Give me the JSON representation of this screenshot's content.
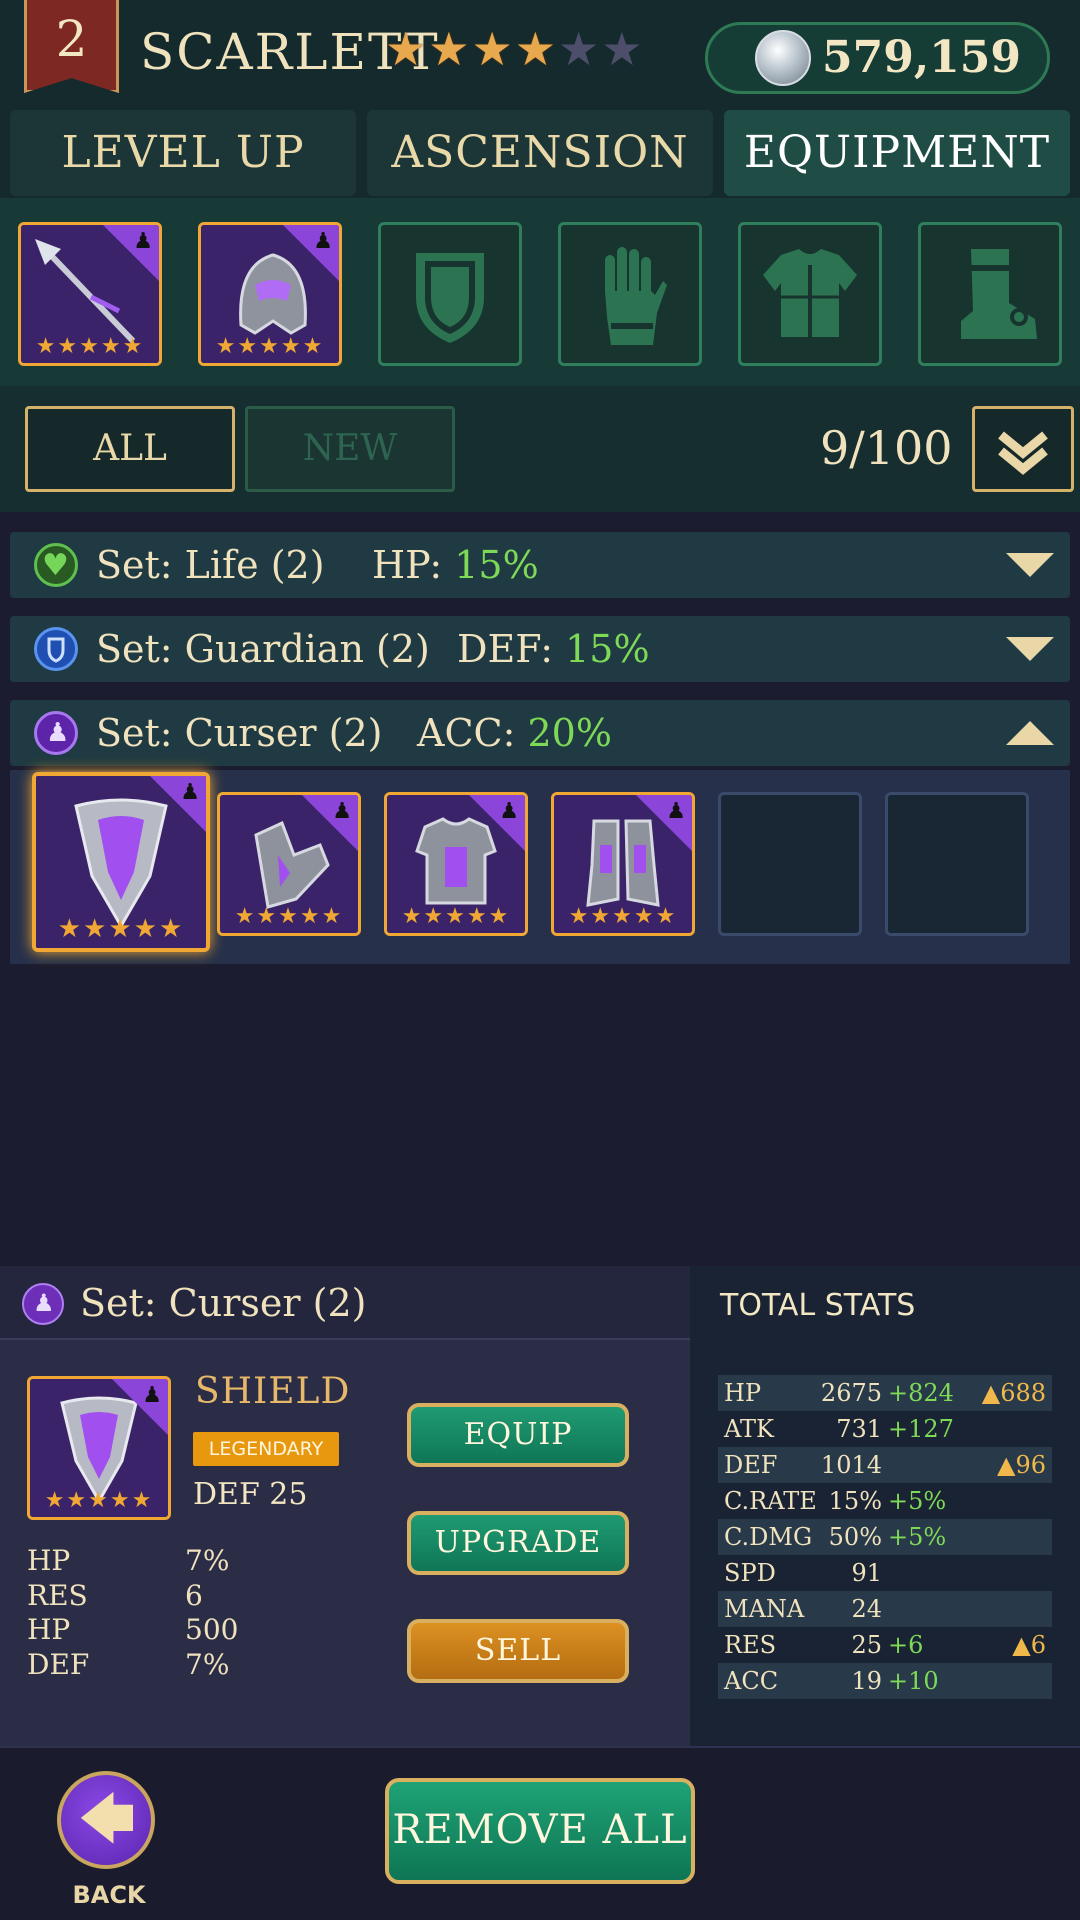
{
  "header": {
    "level": "2",
    "hero_name": "SCARLETT",
    "stars_filled": 4,
    "stars_total": 6,
    "currency": "579,159",
    "currency_icon": "silver-coin-icon"
  },
  "tabs": [
    {
      "label": "LEVEL UP",
      "active": false
    },
    {
      "label": "ASCENSION",
      "active": false
    },
    {
      "label": "EQUIPMENT",
      "active": true
    }
  ],
  "equipped_slots": [
    {
      "slot": "weapon",
      "filled": true,
      "stars": "★★★★★",
      "icon": "spear-icon"
    },
    {
      "slot": "helmet",
      "filled": true,
      "stars": "★★★★★",
      "icon": "helmet-icon"
    },
    {
      "slot": "shield",
      "filled": false,
      "icon": "shield-slot-icon"
    },
    {
      "slot": "gloves",
      "filled": false,
      "icon": "glove-slot-icon"
    },
    {
      "slot": "chest",
      "filled": false,
      "icon": "chest-armor-slot-icon"
    },
    {
      "slot": "boots",
      "filled": false,
      "icon": "boot-slot-icon"
    }
  ],
  "filter": {
    "all_label": "ALL",
    "new_label": "NEW",
    "count": "9/100",
    "sort_icon": "chevron-down-icon"
  },
  "sets": [
    {
      "name": "Set: Life (2)",
      "bonus_label": "HP:",
      "bonus_value": "15%",
      "icon": "heart-icon",
      "color": "#53b04a",
      "expanded": false
    },
    {
      "name": "Set: Guardian (2)",
      "bonus_label": "DEF:",
      "bonus_value": "15%",
      "icon": "guardian-shield-icon",
      "color": "#2f6fd6",
      "expanded": false
    },
    {
      "name": "Set: Curser (2)",
      "bonus_label": "ACC:",
      "bonus_value": "20%",
      "icon": "curser-icon",
      "color": "#7a3ad0",
      "expanded": true
    }
  ],
  "curser_items": [
    {
      "filled": true,
      "selected": true,
      "stars": "★★★★★",
      "icon": "curser-shield-icon"
    },
    {
      "filled": true,
      "selected": false,
      "stars": "★★★★★",
      "icon": "curser-gloves-icon"
    },
    {
      "filled": true,
      "selected": false,
      "stars": "★★★★★",
      "icon": "curser-chest-icon"
    },
    {
      "filled": true,
      "selected": false,
      "stars": "★★★★★",
      "icon": "curser-boots-icon"
    },
    {
      "filled": false
    },
    {
      "filled": false
    }
  ],
  "detail": {
    "set_name": "Set: Curser (2)",
    "item_stars": "★★★★★",
    "item_name": "SHIELD",
    "rarity": "LEGENDARY",
    "main_stat": "DEF  25",
    "substats": [
      {
        "label": "HP",
        "value": "7%"
      },
      {
        "label": "RES",
        "value": "6"
      },
      {
        "label": "HP",
        "value": "500"
      },
      {
        "label": "DEF",
        "value": "7%"
      }
    ],
    "buttons": {
      "equip": "EQUIP",
      "upgrade": "UPGRADE",
      "sell": "SELL"
    }
  },
  "total_stats": {
    "title": "TOTAL STATS",
    "rows": [
      {
        "name": "HP",
        "value": "2675",
        "bonus": "+824",
        "change": "▲688"
      },
      {
        "name": "ATK",
        "value": "731",
        "bonus": "+127",
        "change": ""
      },
      {
        "name": "DEF",
        "value": "1014",
        "bonus": "",
        "change": "▲96"
      },
      {
        "name": "C.RATE",
        "value": "15%",
        "bonus": "+5%",
        "change": ""
      },
      {
        "name": "C.DMG",
        "value": "50%",
        "bonus": "+5%",
        "change": ""
      },
      {
        "name": "SPD",
        "value": "91",
        "bonus": "",
        "change": ""
      },
      {
        "name": "MANA",
        "value": "24",
        "bonus": "",
        "change": ""
      },
      {
        "name": "RES",
        "value": "25",
        "bonus": "+6",
        "change": "▲6"
      },
      {
        "name": "ACC",
        "value": "19",
        "bonus": "+10",
        "change": ""
      }
    ]
  },
  "footer": {
    "back_label": "BACK",
    "back_icon": "back-arrow-icon",
    "remove_all_label": "REMOVE ALL"
  }
}
